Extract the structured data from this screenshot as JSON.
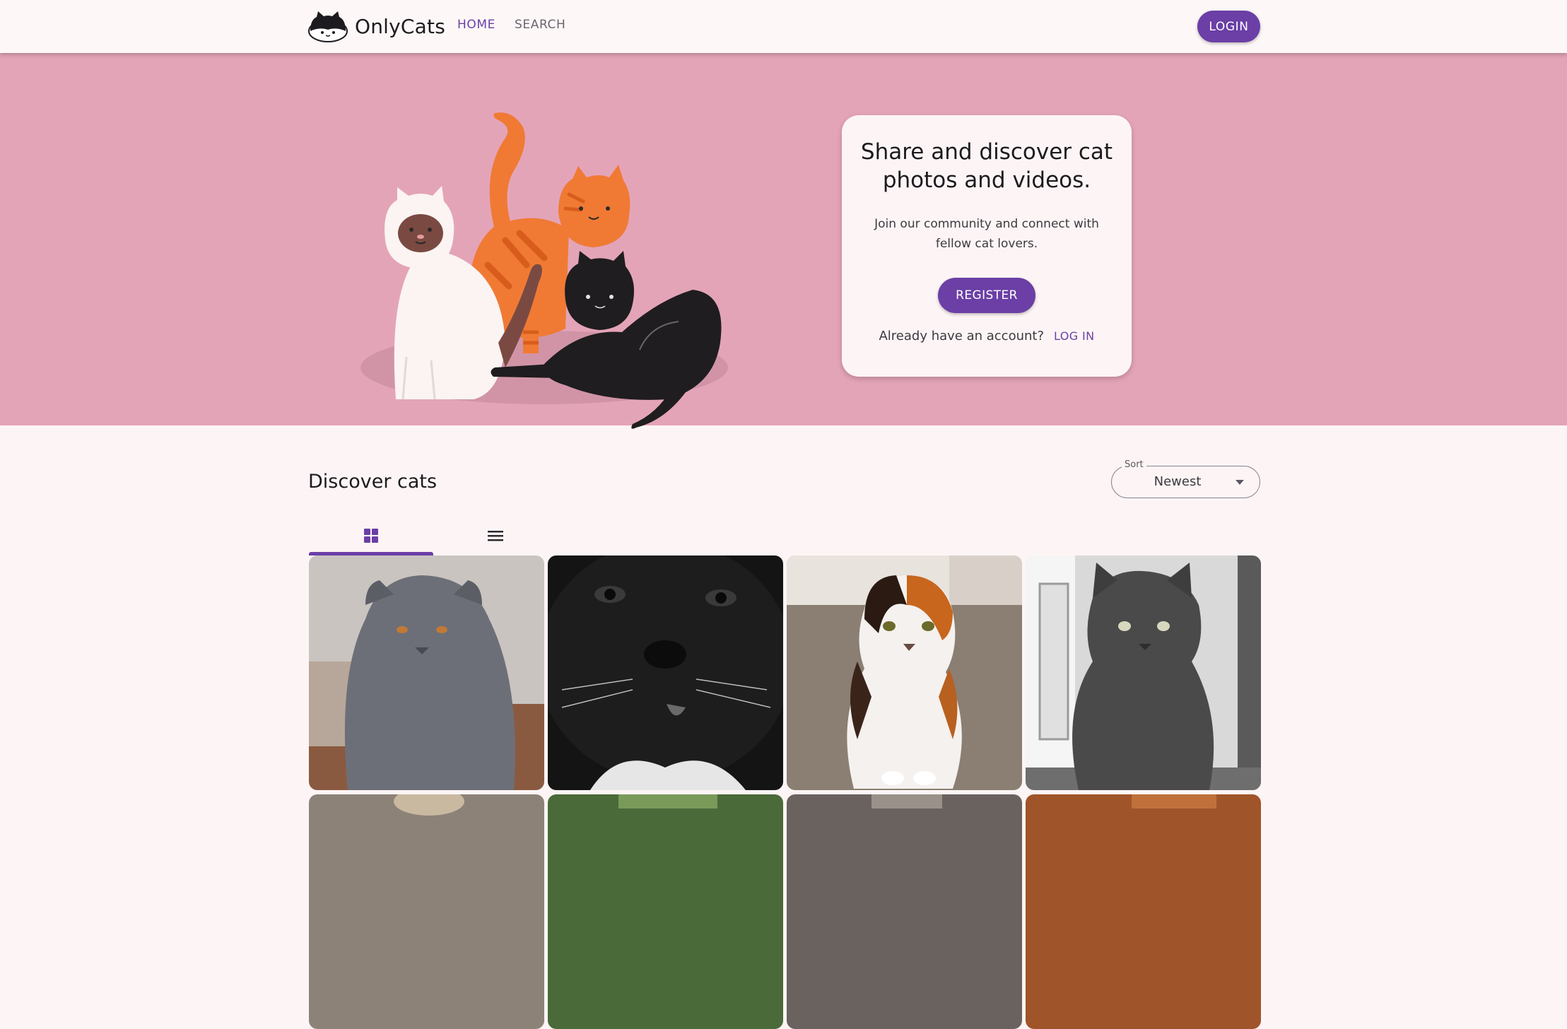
{
  "header": {
    "brand": "OnlyCats",
    "nav": [
      {
        "label": "HOME",
        "active": true
      },
      {
        "label": "SEARCH",
        "active": false
      }
    ],
    "login_label": "LOGIN"
  },
  "hero": {
    "title": "Share and discover cat photos and videos.",
    "subtitle": "Join our community and connect with fellow cat lovers.",
    "register_label": "REGISTER",
    "account_prompt": "Already have an account?",
    "login_link": "LOG IN"
  },
  "discover": {
    "title": "Discover cats",
    "sort": {
      "label": "Sort",
      "value": "Newest"
    },
    "tabs": [
      {
        "icon": "grid-view-icon",
        "active": true
      },
      {
        "icon": "list-view-icon",
        "active": false
      }
    ]
  },
  "colors": {
    "primary": "#6b3fa6",
    "hero_background": "#e4a4b8",
    "page_background": "#fdf5f5"
  }
}
